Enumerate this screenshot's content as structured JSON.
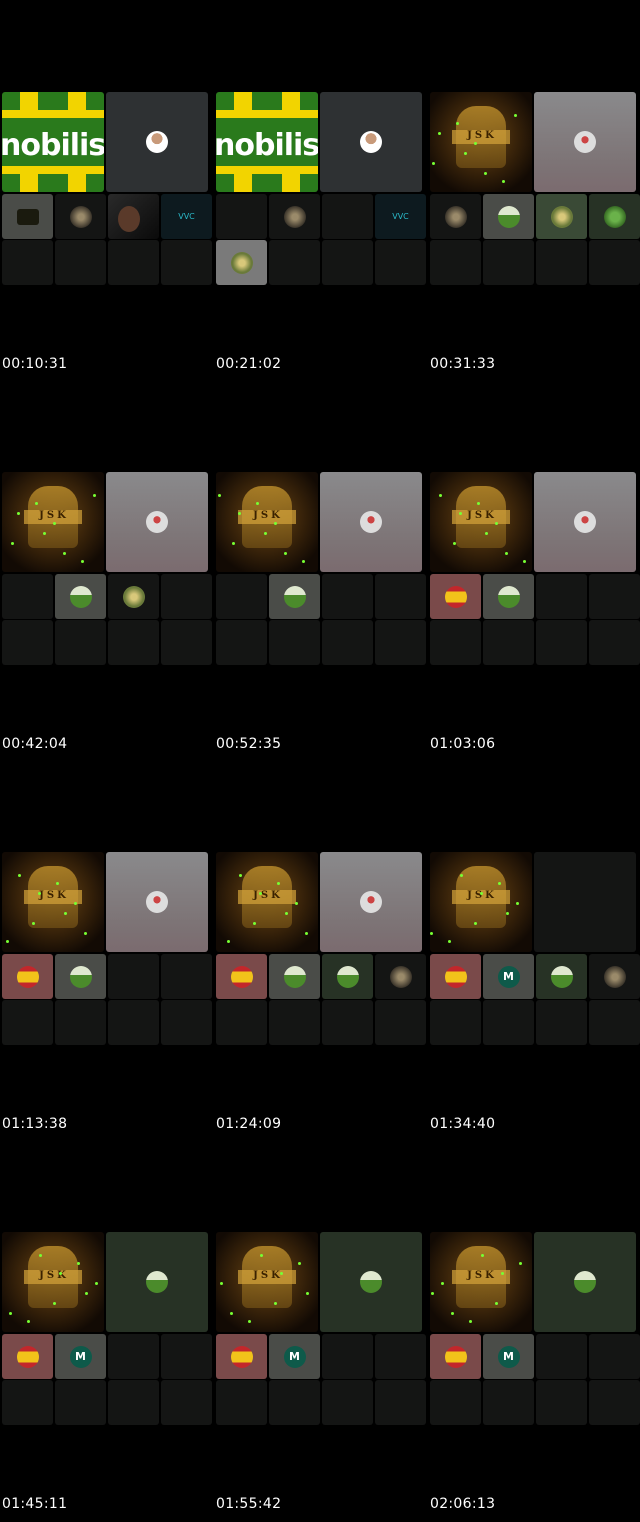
{
  "frames": [
    {
      "timestamp": "00:10:31"
    },
    {
      "timestamp": "00:21:02"
    },
    {
      "timestamp": "00:31:33"
    },
    {
      "timestamp": "00:42:04"
    },
    {
      "timestamp": "00:52:35"
    },
    {
      "timestamp": "01:03:06"
    },
    {
      "timestamp": "01:13:38"
    },
    {
      "timestamp": "01:24:09"
    },
    {
      "timestamp": "01:34:40"
    },
    {
      "timestamp": "01:45:11"
    },
    {
      "timestamp": "01:55:42"
    },
    {
      "timestamp": "02:06:13"
    }
  ],
  "logos": {
    "mobilis_word": "nobilis",
    "jsk_letters": "JSK",
    "vvc_label": "VVC"
  },
  "avatar_initial": "M",
  "colors": {
    "background": "#000000",
    "tile_dark": "#151515",
    "mobilis_green": "#2a7a1c",
    "mobilis_yellow": "#f2d400"
  }
}
